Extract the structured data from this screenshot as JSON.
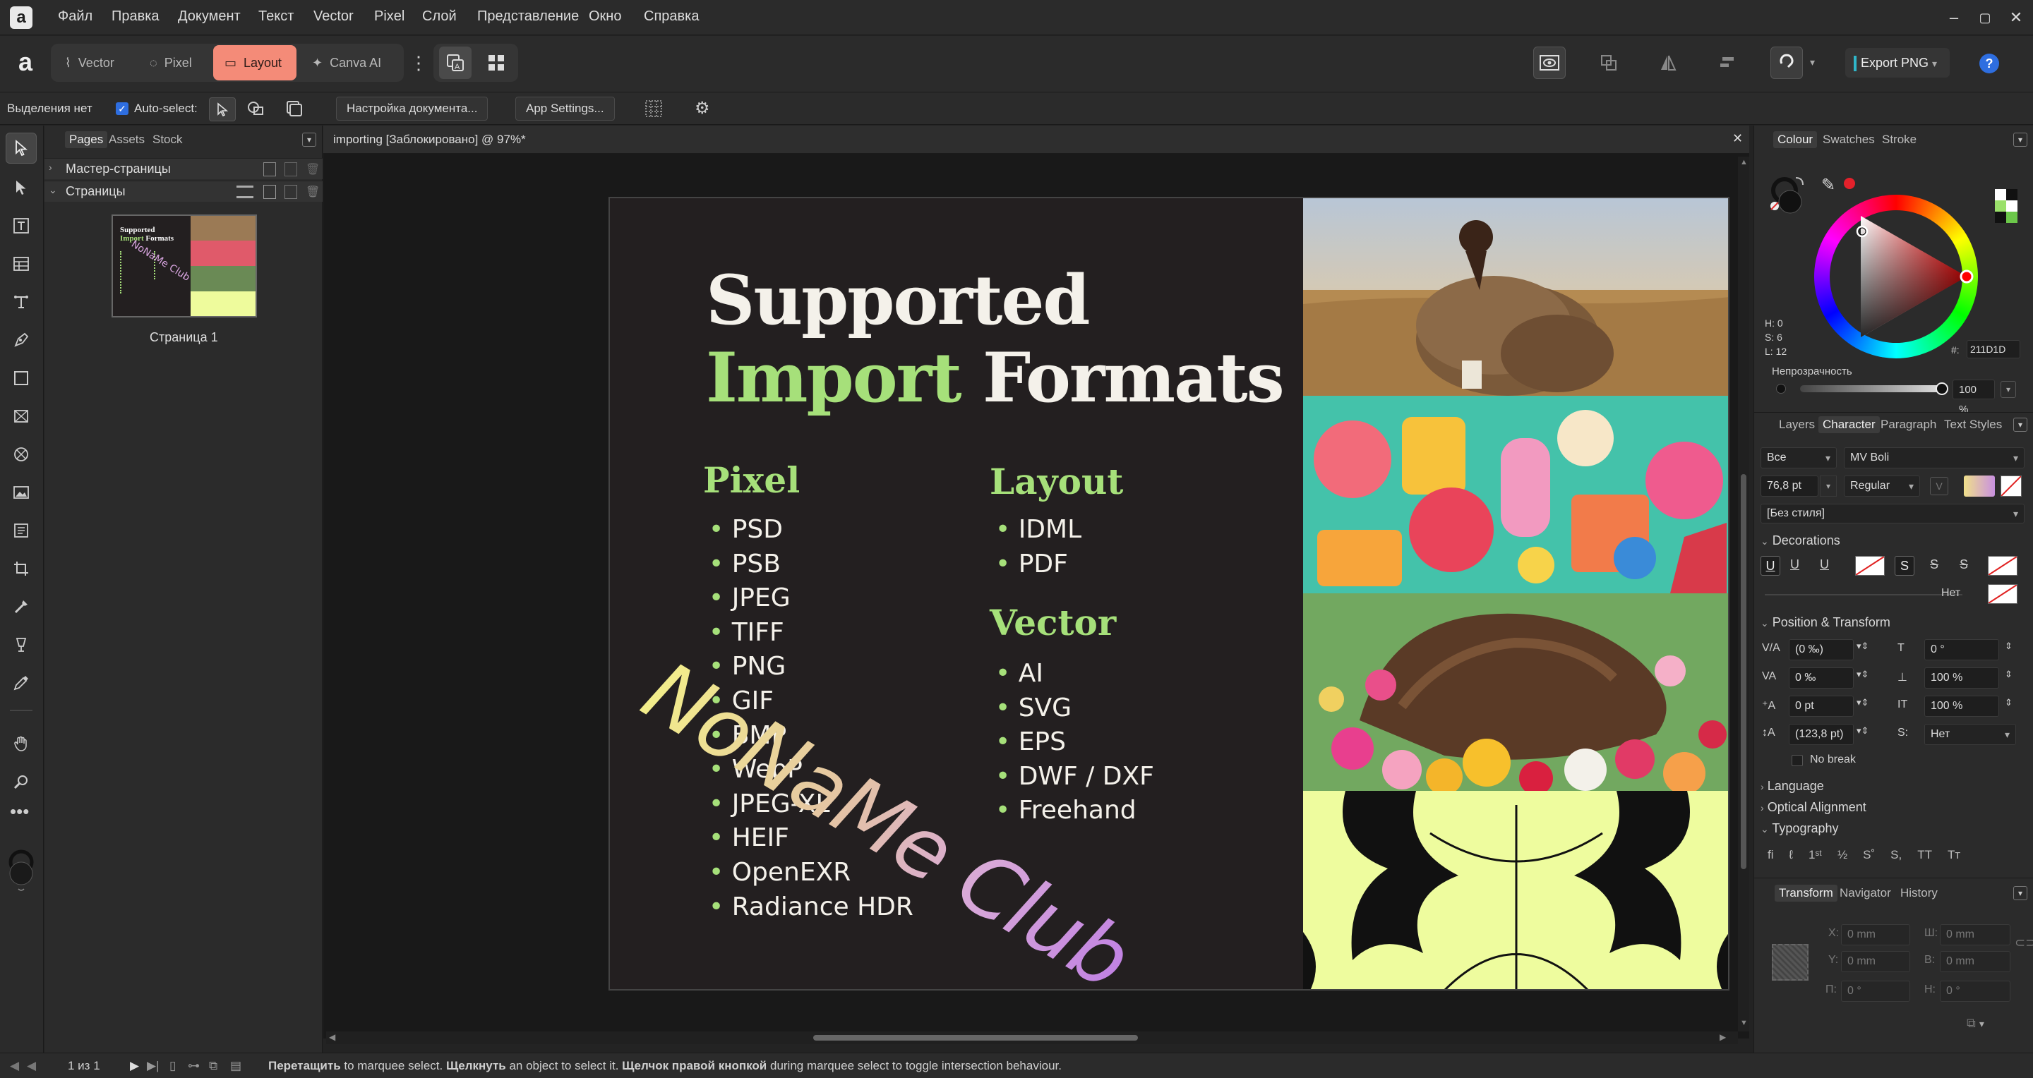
{
  "menubar": {
    "items": [
      "Файл",
      "Правка",
      "Документ",
      "Текст",
      "Vector",
      "Pixel",
      "Слой",
      "Представление",
      "Окно",
      "Справка"
    ]
  },
  "toolbar": {
    "personas": [
      "Vector",
      "Pixel",
      "Layout",
      "Canva AI"
    ],
    "active_persona": "Layout",
    "export_label": "Export PNG",
    "help": "?"
  },
  "contextbar": {
    "selection_status": "Выделения нет",
    "auto_select": "Auto-select:",
    "doc_setup": "Настройка документа...",
    "app_settings": "App Settings..."
  },
  "pages_panel": {
    "tabs": [
      "Pages",
      "Assets",
      "Stock"
    ],
    "master_pages": "Мастер-страницы",
    "pages": "Страницы",
    "page_name": "Страница 1"
  },
  "document": {
    "tab_title": "importing [Заблокировано] @ 97%*"
  },
  "artboard": {
    "title_line1": "Supported",
    "title_line2_accent": "Import",
    "title_line2_rest": "Formats",
    "pixel_heading": "Pixel",
    "pixel_formats": [
      "PSD",
      "PSB",
      "JPEG",
      "TIFF",
      "PNG",
      "GIF",
      "BMP",
      "WebP",
      "JPEG-XL",
      "HEIF",
      "OpenEXR",
      "Radiance HDR"
    ],
    "layout_heading": "Layout",
    "layout_formats": [
      "IDML",
      "PDF"
    ],
    "vector_heading": "Vector",
    "vector_formats": [
      "AI",
      "SVG",
      "EPS",
      "DWF / DXF",
      "Freehand"
    ],
    "watermark": "NoNaMe Club",
    "accent_color": "#a6e07a",
    "background_color": "#231f20"
  },
  "colour_panel": {
    "tabs": [
      "Colour",
      "Swatches",
      "Stroke"
    ],
    "hsl": [
      "H: 0",
      "S: 6",
      "L: 12"
    ],
    "hex_label": "#:",
    "hex_value": "211D1D",
    "opacity_label": "Непрозрачность",
    "opacity_value": "100 %"
  },
  "character_panel": {
    "tabs": [
      "Layers",
      "Character",
      "Paragraph",
      "Text Styles"
    ],
    "scope": "Все",
    "font": "MV Boli",
    "size": "76,8 pt",
    "weight": "Regular",
    "style": "[Без стиля]",
    "decorations": "Decorations",
    "none_label": "Нет",
    "position_transform": "Position & Transform",
    "kerning": "(0 ‰)",
    "tracking": "0 ‰",
    "baseline": "0 pt",
    "leading": "(123,8 pt)",
    "skew": "0 °",
    "hscale": "100 %",
    "vscale": "100 %",
    "caps": "Нет",
    "no_break": "No break",
    "language": "Language",
    "optical": "Optical Alignment",
    "typography": "Typography"
  },
  "transform_panel": {
    "tabs": [
      "Transform",
      "Navigator",
      "History"
    ],
    "x_label": "X:",
    "x": "0 mm",
    "y_label": "Y:",
    "y": "0 mm",
    "w_label": "Ш:",
    "w": "0 mm",
    "h_label": "В:",
    "h": "0 mm",
    "r_label": "П:",
    "r": "0 °",
    "s_label": "Н:",
    "s": "0 °"
  },
  "statusbar": {
    "page_counter": "1 из 1",
    "hint_b1": "Перетащить",
    "hint_t1": " to marquee select. ",
    "hint_b2": "Щелкнуть",
    "hint_t2": " an object to select it. ",
    "hint_b3": "Щелчок правой кнопкой",
    "hint_t3": " during marquee select to toggle intersection behaviour."
  }
}
